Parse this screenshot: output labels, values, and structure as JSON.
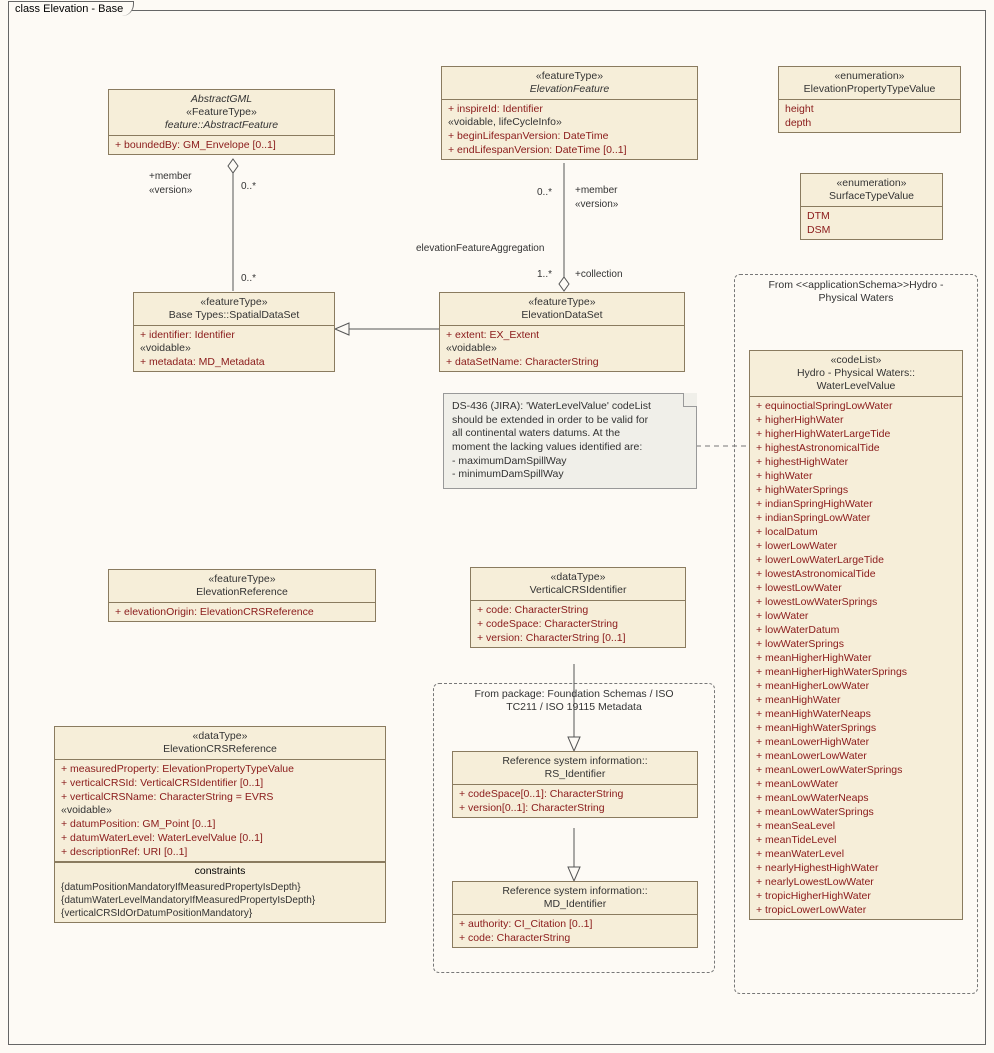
{
  "frame_title": "class Elevation - Base",
  "classes": {
    "abstractFeature": {
      "super": "AbstractGML",
      "stereo": "«FeatureType»",
      "name": "feature::AbstractFeature",
      "attrs": [
        "+   boundedBy:  GM_Envelope [0..1]"
      ]
    },
    "spatialDataSet": {
      "stereo": "«featureType»",
      "name": "Base Types::SpatialDataSet",
      "attrs1": [
        "+   identifier:  Identifier"
      ],
      "sub1": "«voidable»",
      "attrs2": [
        "+   metadata:  MD_Metadata"
      ]
    },
    "elevationFeature": {
      "stereo": "«featureType»",
      "name": "ElevationFeature",
      "attrs1": [
        "+   inspireId:  Identifier"
      ],
      "sub1": "«voidable, lifeCycleInfo»",
      "attrs2": [
        "+   beginLifespanVersion:  DateTime",
        "+   endLifespanVersion:  DateTime [0..1]"
      ]
    },
    "elevationDataSet": {
      "stereo": "«featureType»",
      "name": "ElevationDataSet",
      "attrs1": [
        "+   extent:  EX_Extent"
      ],
      "sub1": "«voidable»",
      "attrs2": [
        "+   dataSetName:  CharacterString"
      ]
    },
    "enum1": {
      "stereo": "«enumeration»",
      "name": "ElevationPropertyTypeValue",
      "vals": [
        "height",
        "depth"
      ]
    },
    "enum2": {
      "stereo": "«enumeration»",
      "name": "SurfaceTypeValue",
      "vals": [
        "DTM",
        "DSM"
      ]
    },
    "waterLevel": {
      "stereo": "«codeList»",
      "name1": "Hydro - Physical Waters::",
      "name2": "WaterLevelValue",
      "vals": [
        "equinoctialSpringLowWater",
        "higherHighWater",
        "higherHighWaterLargeTide",
        "highestAstronomicalTide",
        "highestHighWater",
        "highWater",
        "highWaterSprings",
        "indianSpringHighWater",
        "indianSpringLowWater",
        "localDatum",
        "lowerLowWater",
        "lowerLowWaterLargeTide",
        "lowestAstronomicalTide",
        "lowestLowWater",
        "lowestLowWaterSprings",
        "lowWater",
        "lowWaterDatum",
        "lowWaterSprings",
        "meanHigherHighWater",
        "meanHigherHighWaterSprings",
        "meanHigherLowWater",
        "meanHighWater",
        "meanHighWaterNeaps",
        "meanHighWaterSprings",
        "meanLowerHighWater",
        "meanLowerLowWater",
        "meanLowerLowWaterSprings",
        "meanLowWater",
        "meanLowWaterNeaps",
        "meanLowWaterSprings",
        "meanSeaLevel",
        "meanTideLevel",
        "meanWaterLevel",
        "nearlyHighestHighWater",
        "nearlyLowestLowWater",
        "tropicHigherHighWater",
        "tropicLowerLowWater"
      ]
    },
    "elevRef": {
      "stereo": "«featureType»",
      "name": "ElevationReference",
      "attrs": [
        "+   elevationOrigin:  ElevationCRSReference"
      ]
    },
    "vcrs": {
      "stereo": "«dataType»",
      "name": "VerticalCRSIdentifier",
      "attrs": [
        "+   code:  CharacterString",
        "+   codeSpace:  CharacterString",
        "+   version:  CharacterString [0..1]"
      ]
    },
    "elevCRS": {
      "stereo": "«dataType»",
      "name": "ElevationCRSReference",
      "attrs1": [
        "+   measuredProperty:  ElevationPropertyTypeValue",
        "+   verticalCRSId:  VerticalCRSIdentifier [0..1]",
        "+   verticalCRSName:  CharacterString = EVRS"
      ],
      "sub1": "«voidable»",
      "attrs2": [
        "+   datumPosition:  GM_Point [0..1]",
        "+   datumWaterLevel:  WaterLevelValue [0..1]",
        "+   descriptionRef:  URI [0..1]"
      ],
      "constraints_head": "constraints",
      "constraints": [
        "{datumPositionMandatoryIfMeasuredPropertyIsDepth}",
        "{datumWaterLevelMandatoryIfMeasuredPropertyIsDepth}",
        "{verticalCRSIdOrDatumPositionMandatory}"
      ]
    },
    "rsId": {
      "name1": "Reference system information::",
      "name2": "RS_Identifier",
      "attrs": [
        "+   codeSpace[0..1]:  CharacterString",
        "+   version[0..1]:  CharacterString"
      ]
    },
    "mdId": {
      "name1": "Reference system information::",
      "name2": "MD_Identifier",
      "attrs": [
        "+   authority:  CI_Citation [0..1]",
        "+   code:  CharacterString"
      ]
    }
  },
  "note": {
    "l1": "DS-436 (JIRA): 'WaterLevelValue' codeList",
    "l2": "should be extended in order to be valid for",
    "l3": "all continental waters datums. At the",
    "l4": "moment the lacking values identified are:",
    "l5": "- maximumDamSpillWay",
    "l6": "- minimumDamSpillWay"
  },
  "pkg1": {
    "l1": "From package: Foundation Schemas / ISO",
    "l2": "TC211 / ISO 19115 Metadata"
  },
  "pkg2": {
    "l1": "From <<applicationSchema>>Hydro -",
    "l2": "Physical Waters"
  },
  "assoc": {
    "member": "+member",
    "version": "«version»",
    "zeroMany": "0..*",
    "oneMany": "1..*",
    "collection": "+collection",
    "aggLabel": "elevationFeatureAggregation"
  }
}
